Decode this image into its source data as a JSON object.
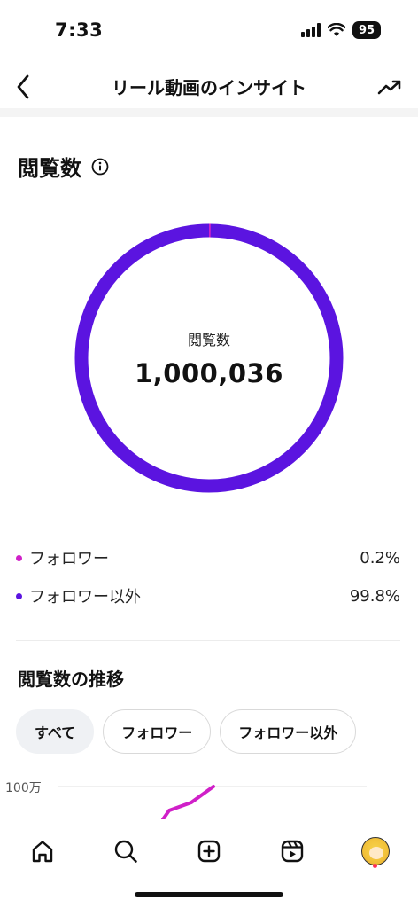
{
  "status_bar": {
    "time": "7:33",
    "battery": "95",
    "icons": [
      "cellular-signal-icon",
      "wifi-icon",
      "battery-icon"
    ]
  },
  "header": {
    "title": "リール動画のインサイト",
    "back_icon": "chevron-left-icon",
    "right_icon": "trending-up-icon"
  },
  "views_section": {
    "title": "閲覧数",
    "info_icon": "info-icon",
    "donut": {
      "label": "閲覧数",
      "value": "1,000,036",
      "ring_color": "#5b14e0"
    },
    "breakdown": [
      {
        "label": "フォロワー",
        "value": "0.2%",
        "percent": 0.2,
        "color": "#d020c8"
      },
      {
        "label": "フォロワー以外",
        "value": "99.8%",
        "percent": 99.8,
        "color": "#5b14e0"
      }
    ]
  },
  "trend_section": {
    "title": "閲覧数の推移",
    "chips": [
      {
        "label": "すべて",
        "active": true
      },
      {
        "label": "フォロワー",
        "active": false
      },
      {
        "label": "フォロワー以外",
        "active": false
      }
    ],
    "axis_label": "100万",
    "line_color": "#d020c8"
  },
  "bottom_nav": {
    "items": [
      "home-icon",
      "search-icon",
      "create-icon",
      "reels-icon",
      "profile-avatar"
    ]
  }
}
